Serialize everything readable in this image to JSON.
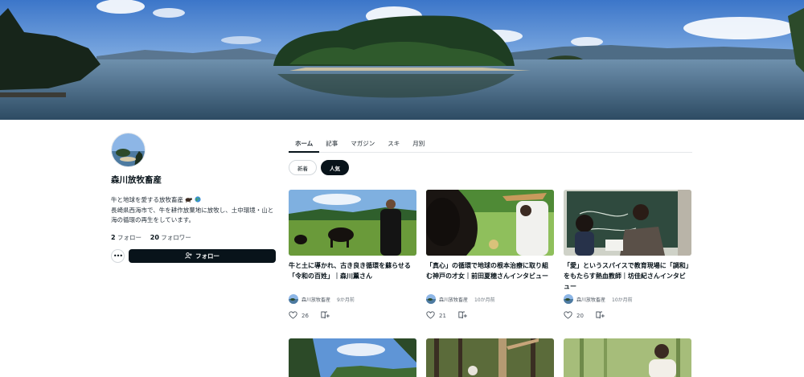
{
  "creator": {
    "name": "森川放牧畜産",
    "bio_line1": "牛と地球を愛する放牧畜産",
    "bio_line2": "長崎県西海市で、牛を耕作放棄地に放牧し、土中環境・山と海の循環の再生をしています。",
    "following_count": "2",
    "following_label": "フォロー",
    "followers_count": "20",
    "followers_label": "フォロワー",
    "follow_button": "フォロー"
  },
  "tabs": [
    "ホーム",
    "記事",
    "マガジン",
    "スキ",
    "月別"
  ],
  "filters": [
    "新着",
    "人気"
  ],
  "articles": [
    {
      "title": "牛と土に導かれ、古き良き循環を蘇らせる「令和の百姓」｜森川薫さん",
      "author": "森川放牧畜産",
      "ago": "9か月前",
      "likes": "26"
    },
    {
      "title": "「真心」の循環で地球の根本治療に取り組む神戸の才女｜前田夏穂さんインタビュー",
      "author": "森川放牧畜産",
      "ago": "10か月前",
      "likes": "21"
    },
    {
      "title": "「愛」というスパイスで教育現場に「調和」をもたらす熱血教師｜坊佳紀さんインタビュー",
      "author": "森川放牧畜産",
      "ago": "10か月前",
      "likes": "20"
    }
  ],
  "icons": {
    "more": "ellipsis-icon",
    "follow": "person-add-icon",
    "like": "heart-icon",
    "magazine": "magazine-add-icon"
  },
  "colors": {
    "primary": "#08131a",
    "border": "#d3d8dc"
  }
}
